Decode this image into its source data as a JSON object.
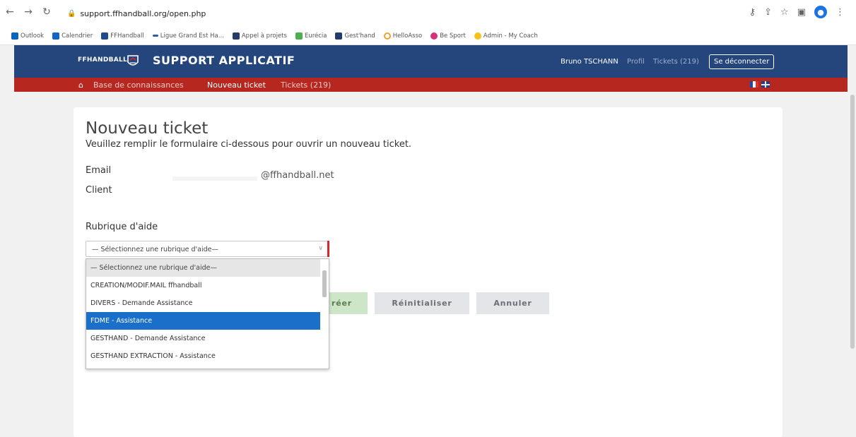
{
  "browser": {
    "url": "support.ffhandball.org/open.php",
    "bookmarks": [
      "Outlook",
      "Calendrier",
      "FFHandball",
      "Ligue Grand Est Ha...",
      "Appel à projets",
      "Eurécia",
      "Gest'hand",
      "HelloAsso",
      "Be Sport",
      "Admin - My Coach"
    ]
  },
  "header": {
    "logo_text": "FFHANDBALL",
    "brand": "SUPPORT APPLICATIF",
    "user": "Bruno TSCHANN",
    "profile_link": "Profil",
    "tickets_link": "Tickets (219)",
    "logout_label": "Se déconnecter"
  },
  "subnav": {
    "knowledge_base": "Base de connaissances",
    "new_ticket": "Nouveau ticket",
    "tickets": "Tickets (219)"
  },
  "form": {
    "title": "Nouveau ticket",
    "subtitle": "Veuillez remplir le formulaire ci-dessous pour ouvrir un nouveau ticket.",
    "email_label": "Email",
    "email_value": "@ffhandball.net",
    "client_label": "Client",
    "help_topic_label": "Rubrique d'aide",
    "select_value": "— Sélectionnez une rubrique d'aide—",
    "options": [
      "— Sélectionnez une rubrique d'aide—",
      "CREATION/MODIF.MAIL ffhandball",
      "DIVERS - Demande Assistance",
      "FDME - Assistance",
      "GESTHAND - Demande Assistance",
      "GESTHAND EXTRACTION - Assistance"
    ],
    "highlighted_option_index": 3,
    "create_label": "réer",
    "reset_label": "Réinitialiser",
    "cancel_label": "Annuler"
  },
  "colors": {
    "header_blue": "#24467c",
    "subnav_red": "#b5271f",
    "selected_blue": "#1a6fc9"
  }
}
